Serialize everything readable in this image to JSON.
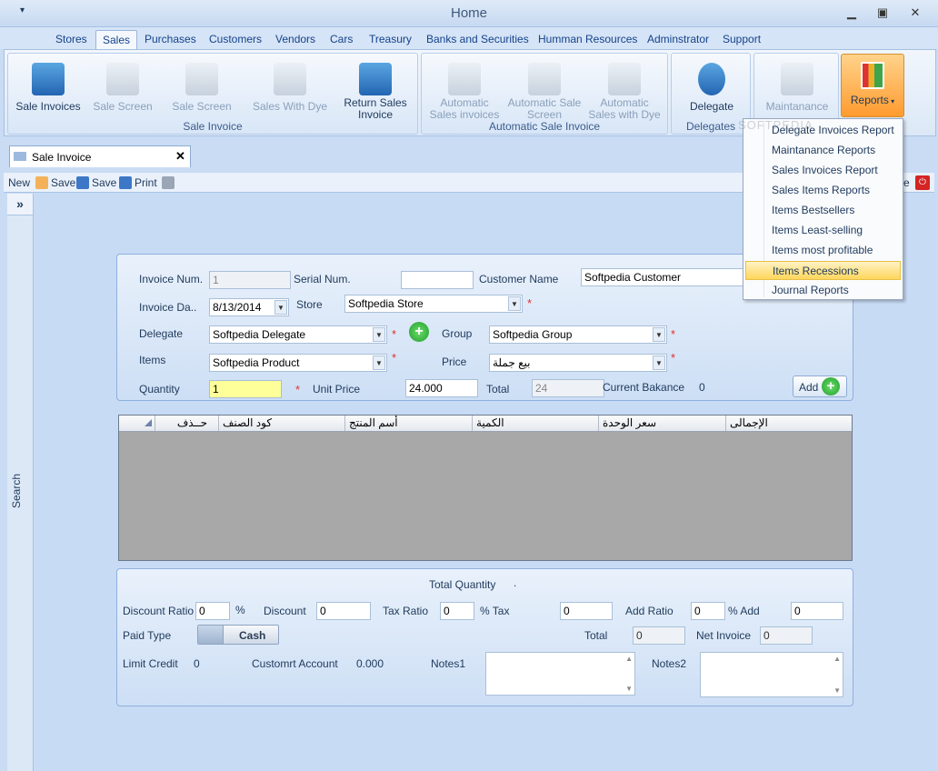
{
  "window": {
    "title": "Home"
  },
  "menu": [
    "Stores",
    "Sales",
    "Purchases",
    "Customers",
    "Vendors",
    "Cars",
    "Treasury",
    "Banks and Securities",
    "Humman Resources",
    "Adminstrator",
    "Support"
  ],
  "ribbon": {
    "sale_invoice_group": {
      "label": "Sale Invoice",
      "buttons": [
        "Sale Invoices",
        "Sale Screen",
        "Sale Screen",
        "Sales With Dye",
        "Return Sales Invoice"
      ]
    },
    "automatic_group": {
      "label": "Automatic Sale Invoice",
      "buttons": [
        "Automatic Sales invoices",
        "Automatic Sale Screen",
        "Automatic Sales with Dye"
      ]
    },
    "delegates_group": {
      "label": "Delegates",
      "button": "Delegate"
    },
    "maintanance": "Maintanance",
    "reports": "Reports"
  },
  "reports_menu": [
    "Delegate Invoices Report",
    "Maintanance Reports",
    "Sales Invoices Report",
    "Sales Items Reports",
    "Items Bestsellers",
    "Items Least-selling",
    "Items most profitable",
    "Items Recessions",
    "Journal Reports"
  ],
  "doc_tab": {
    "label": "Sale Invoice"
  },
  "toolbar": {
    "new": "New",
    "save1": "Save",
    "save2": "Save",
    "print": "Print",
    "close": "e"
  },
  "sidebar": {
    "expand": "»",
    "search": "Search"
  },
  "form": {
    "invoice_num_label": "Invoice Num.",
    "invoice_num": "1",
    "serial_label": "Serial Num.",
    "serial": "",
    "customer_label": "Customer Name",
    "customer": "Softpedia Customer",
    "invoice_date_label": "Invoice Da..",
    "invoice_date": "8/13/2014",
    "store_label": "Store",
    "store": "Softpedia Store",
    "delegate_label": "Delegate",
    "delegate": "Softpedia Delegate",
    "group_label": "Group",
    "group": "Softpedia Group",
    "items_label": "Items",
    "item": "Softpedia Product",
    "price_label": "Price",
    "price": "بيع جملة",
    "quantity_label": "Quantity",
    "quantity": "1",
    "unit_price_label": "Unit Price",
    "unit_price": "24.000",
    "total_label": "Total",
    "total": "24",
    "balance_label": "Current Bakance",
    "balance": "0",
    "add_label": "Add"
  },
  "grid": {
    "columns": [
      "حــذف",
      "كود الصنف",
      "أسم المنتج",
      "الكمية",
      "سعر الوحدة",
      "الإجمالى"
    ]
  },
  "summary": {
    "total_qty_label": "Total Quantity",
    "total_qty": ".",
    "discount_ratio_label": "Discount Ratio",
    "discount_ratio": "0",
    "pct1": "%",
    "discount_label": "Discount",
    "discount": "0",
    "tax_ratio_label": "Tax Ratio",
    "tax_ratio": "0",
    "tax_label": "% Tax",
    "tax": "0",
    "add_ratio_label": "Add Ratio",
    "add_ratio": "0",
    "add_label": "% Add",
    "add": "0",
    "paid_type_label": "Paid Type",
    "paid_type": "Cash",
    "total_label": "Total",
    "total": "0",
    "net_label": "Net Invoice",
    "net": "0",
    "limit_label": "Limit Credit",
    "limit": "0",
    "account_label": "Customrt Account",
    "account": "0.000",
    "notes1_label": "Notes1",
    "notes2_label": "Notes2"
  },
  "watermark": "SOFTPEDIA"
}
